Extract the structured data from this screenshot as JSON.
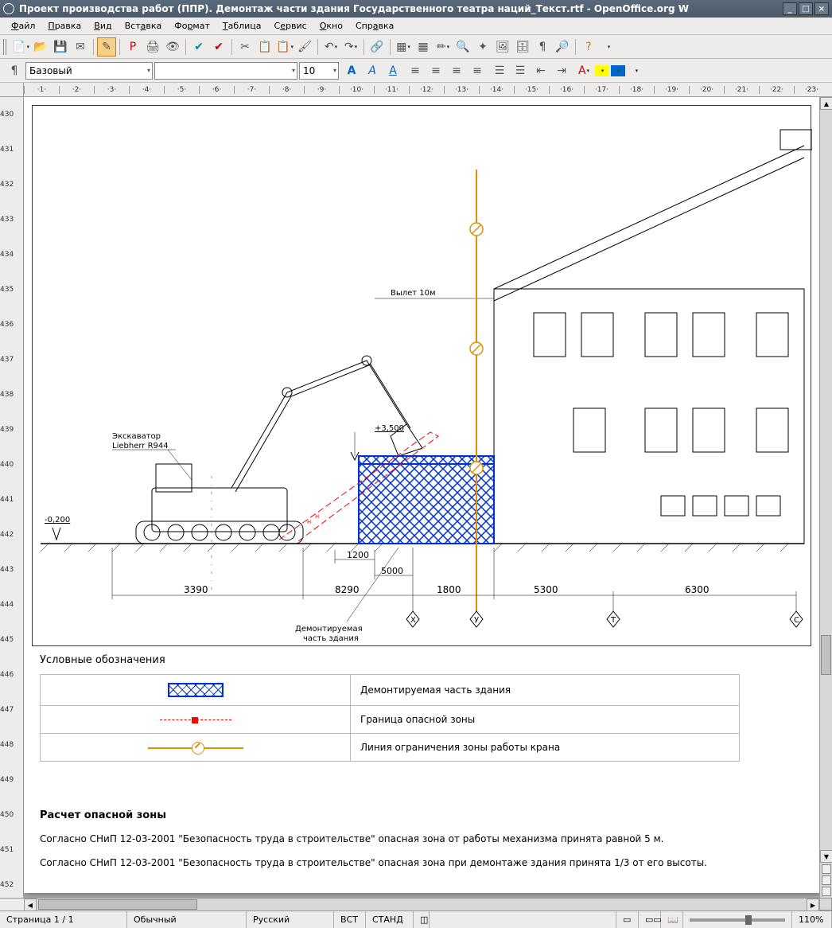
{
  "window": {
    "title": "Проект производства работ (ППР). Демонтаж части здания Государственного театра наций_Текст.rtf - OpenOffice.org W"
  },
  "menu": {
    "file": "Файл",
    "edit": "Правка",
    "view": "Вид",
    "insert": "Вставка",
    "format": "Формат",
    "table": "Таблица",
    "tools": "Сервис",
    "window": "Окно",
    "help": "Справка"
  },
  "format_toolbar": {
    "style": "Базовый",
    "font": "",
    "size": "10"
  },
  "hruler": [
    "·1·",
    "·2·",
    "·3·",
    "·4·",
    "·5·",
    "·6·",
    "·7·",
    "·8·",
    "·9·",
    "·10·",
    "·11·",
    "·12·",
    "·13·",
    "·14·",
    "·15·",
    "·16·",
    "·17·",
    "·18·",
    "·19·",
    "·20·",
    "·21·",
    "·22·",
    "·23·"
  ],
  "vruler": [
    "430",
    "431",
    "432",
    "433",
    "434",
    "435",
    "436",
    "437",
    "438",
    "439",
    "440",
    "441",
    "442",
    "443",
    "444",
    "445",
    "446",
    "447",
    "448",
    "449",
    "450",
    "451",
    "452"
  ],
  "drawing": {
    "excavator_label": "Экскаватор\nLiebherr R944",
    "reach_label": "Вылет 10м",
    "elevation_label": "+3,500",
    "ground_label": "-0,200",
    "demolition_label": "Демонтируемая\nчасть здания",
    "dims": {
      "d1": "3390",
      "d2": "8290",
      "d3": "5000",
      "d4": "1200",
      "d5": "1800",
      "d6": "5300",
      "d7": "6300"
    },
    "axes": {
      "x": "Х",
      "y": "У",
      "t": "Т",
      "c": "С"
    }
  },
  "legend": {
    "title": "Условные обозначения",
    "row1": "Демонтируемая часть здания",
    "row2": "Граница опасной зоны",
    "row3": "Линия ограничения зоны работы крана"
  },
  "calc": {
    "title": "Расчет опасной зоны",
    "p1": "Согласно СНиП 12-03-2001 \"Безопасность труда в строительстве\" опасная зона от работы механизма принята равной 5 м.",
    "p2": "Согласно СНиП 12-03-2001 \"Безопасность труда в строительстве\" опасная зона при демонтаже здания принята 1/3 от его высоты."
  },
  "status": {
    "page": "Страница  1 / 1",
    "style": "Обычный",
    "lang": "Русский",
    "ins": "ВСТ",
    "std": "СТАНД",
    "zoom": "110%"
  }
}
